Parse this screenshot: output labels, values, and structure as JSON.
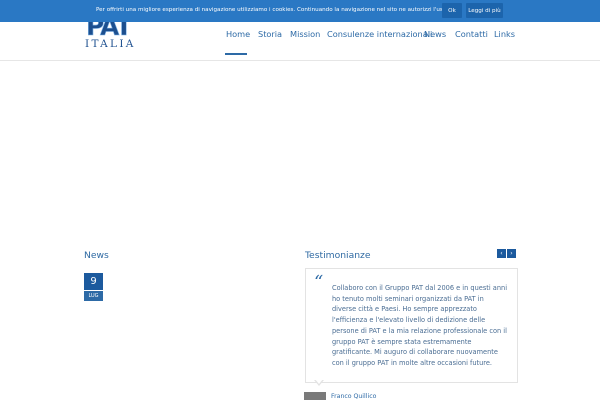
{
  "cookie": {
    "message": "Per offrirti una migliore esperienza di navigazione utilizziamo i cookies. Continuando la navigazione nel sito ne autorizzi l'uso.",
    "ok_label": "Ok",
    "more_label": "Leggi di più"
  },
  "logo": {
    "mark": "PAT",
    "text": "ITALIA"
  },
  "nav": {
    "items": [
      {
        "label": "Home"
      },
      {
        "label": "Storia"
      },
      {
        "label": "Mission"
      },
      {
        "label": "Consulenze internazionali"
      },
      {
        "label": "News"
      },
      {
        "label": "Contatti"
      },
      {
        "label": "Links"
      }
    ],
    "active": "Home"
  },
  "news": {
    "title": "News",
    "day": "9",
    "month": "LUG"
  },
  "testimonials": {
    "title": "Testimonianze",
    "prev_icon": "chevron-left-icon",
    "next_icon": "chevron-right-icon",
    "prev_glyph": "‹",
    "next_glyph": "›",
    "quote_glyph": "“",
    "text": "Collaboro con il Gruppo PAT dal 2006 e in questi anni ho tenuto molti seminari organizzati da PAT in diverse città e Paesi. Ho sempre apprezzato l'efficienza e l'elevato livello di dedizione delle persone di PAT e la mia relazione professionale con il gruppo PAT è sempre stata estremamente gratificante. Mi auguro di collaborare nuovamente con il gruppo PAT in molte altre occasioni future.",
    "author": "Franco Quillico"
  },
  "colors": {
    "accent": "#2d6aa6",
    "cookie_bar": "#2a78c4",
    "brand_dark": "#1c4f8f"
  }
}
